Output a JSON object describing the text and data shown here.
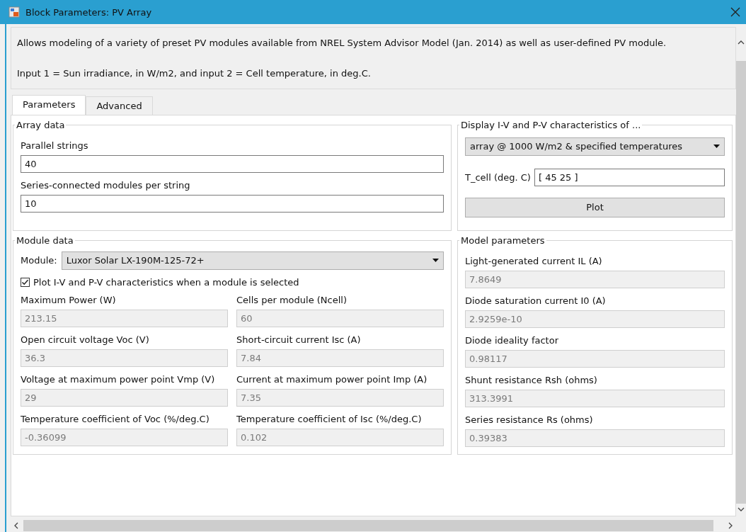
{
  "window": {
    "title": "Block Parameters: PV Array"
  },
  "description": [
    "Allows modeling of a variety of preset PV modules available from NREL System Advisor Model (Jan. 2014) as well as user-defined PV module.",
    "Input 1 = Sun irradiance, in W/m2, and input 2 = Cell temperature, in deg.C."
  ],
  "tabs": [
    {
      "label": "Parameters",
      "selected": true
    },
    {
      "label": "Advanced",
      "selected": false
    }
  ],
  "array_data": {
    "title": "Array data",
    "fields": [
      {
        "label": "Parallel strings",
        "value": "40",
        "disabled": false
      },
      {
        "label": "Series-connected modules per string",
        "value": "10",
        "disabled": false
      }
    ]
  },
  "display": {
    "title": "Display  I-V and P-V characteristics of ...",
    "dropdown": "array @ 1000 W/m2 & specified temperatures",
    "t_cell": {
      "label": "T_cell (deg. C)",
      "value": "[ 45 25  ]"
    },
    "plot_button": "Plot"
  },
  "module_data": {
    "title": "Module data",
    "module_label": "Module:",
    "module_value": "Luxor Solar LX-190M-125-72+",
    "checkbox": {
      "label": "Plot I-V and P-V characteristics when a module is selected",
      "checked": true
    },
    "fields": [
      {
        "label": "Maximum Power (W)",
        "value": "213.15",
        "disabled": true
      },
      {
        "label": "Cells per module (Ncell)",
        "value": "60",
        "disabled": true
      },
      {
        "label": "Open circuit voltage  Voc (V)",
        "value": "36.3",
        "disabled": true
      },
      {
        "label": "Short-circuit current Isc (A)",
        "value": "7.84",
        "disabled": true
      },
      {
        "label": "Voltage at maximum power point Vmp (V)",
        "value": "29",
        "disabled": true
      },
      {
        "label": "Current at maximum power point Imp (A)",
        "value": "7.35",
        "disabled": true
      },
      {
        "label": "Temperature coefficient of Voc (%/deg.C)",
        "value": "-0.36099",
        "disabled": true
      },
      {
        "label": "Temperature coefficient of Isc (%/deg.C)",
        "value": "0.102",
        "disabled": true
      }
    ]
  },
  "model_parameters": {
    "title": "Model parameters",
    "fields": [
      {
        "label": "Light-generated current IL (A)",
        "value": "7.8649",
        "disabled": true
      },
      {
        "label": "Diode saturation current I0 (A)",
        "value": "2.9259e-10",
        "disabled": true
      },
      {
        "label": "Diode ideality factor",
        "value": "0.98117",
        "disabled": true
      },
      {
        "label": "Shunt resistance Rsh (ohms)",
        "value": "313.3991",
        "disabled": true
      },
      {
        "label": "Series resistance Rs (ohms)",
        "value": "0.39383",
        "disabled": true
      }
    ]
  }
}
